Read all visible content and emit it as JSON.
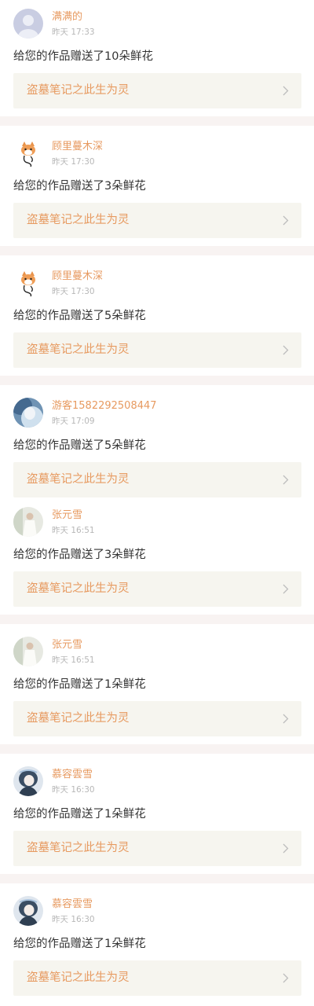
{
  "theme": {
    "accent": "#e79a60",
    "page_bg": "#f8f3f2",
    "card_bg": "#ffffff",
    "link_bg": "#f6f5ef",
    "text": "#333333",
    "muted": "#b7b7b7"
  },
  "notifications": [
    {
      "avatar": "default-avatar",
      "username": "满满的",
      "time": "昨天 17:33",
      "message": "给您的作品赠送了10朵鲜花",
      "work_title": "盗墓笔记之此生为灵"
    },
    {
      "avatar": "cartoon-fox-avatar",
      "username": "顾里蔓木深",
      "time": "昨天 17:30",
      "message": "给您的作品赠送了3朵鲜花",
      "work_title": "盗墓笔记之此生为灵"
    },
    {
      "avatar": "cartoon-fox-avatar",
      "username": "顾里蔓木深",
      "time": "昨天 17:30",
      "message": "给您的作品赠送了5朵鲜花",
      "work_title": "盗墓笔记之此生为灵"
    },
    {
      "avatar": "blue-photo-avatar",
      "username": "游客1582292508447",
      "time": "昨天 17:09",
      "message": "给您的作品赠送了5朵鲜花",
      "work_title": "盗墓笔记之此生为灵"
    },
    {
      "avatar": "white-dress-photo-avatar",
      "username": "张元雪",
      "time": "昨天 16:51",
      "message": "给您的作品赠送了3朵鲜花",
      "work_title": "盗墓笔记之此生为灵"
    },
    {
      "avatar": "white-dress-photo-avatar",
      "username": "张元雪",
      "time": "昨天 16:51",
      "message": "给您的作品赠送了1朵鲜花",
      "work_title": "盗墓笔记之此生为灵"
    },
    {
      "avatar": "anime-girl-avatar",
      "username": "慕容雲雪",
      "time": "昨天 16:30",
      "message": "给您的作品赠送了1朵鲜花",
      "work_title": "盗墓笔记之此生为灵"
    },
    {
      "avatar": "anime-girl-avatar",
      "username": "慕容雲雪",
      "time": "昨天 16:30",
      "message": "给您的作品赠送了1朵鲜花",
      "work_title": "盗墓笔记之此生为灵"
    }
  ]
}
